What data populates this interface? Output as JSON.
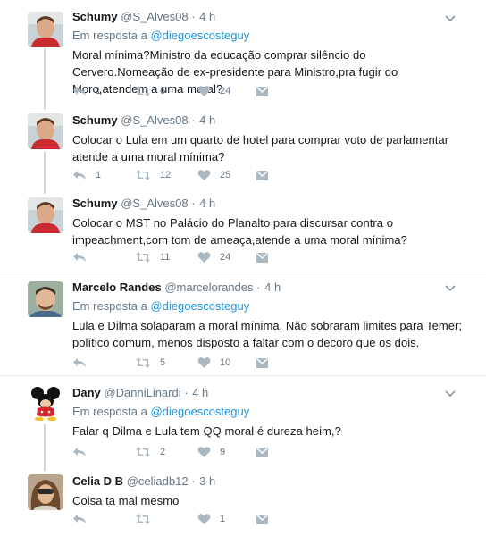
{
  "colors": {
    "link": "#1b95e0",
    "muted": "#657786",
    "text": "#14171a",
    "divider": "#e6ecf0",
    "thread": "#ccd6dd"
  },
  "icons": [
    "reply-icon",
    "retweet-icon",
    "like-icon",
    "direct-message-icon",
    "chevron-down-icon"
  ],
  "tweets": [
    {
      "name": "Schumy",
      "handle": "@S_Alves08",
      "sep": "·",
      "time": "4 h",
      "reply_prefix": "Em resposta a",
      "reply_mention": "@diegoescosteguy",
      "text": "Moral mínima?Ministro da educação comprar silêncio do Cervero.Nomeação de ex-presidente para Ministro,pra fugir do Moro,atendem a uma moral?",
      "replies": "1",
      "retweets": "6",
      "likes": "24"
    },
    {
      "name": "Schumy",
      "handle": "@S_Alves08",
      "sep": "·",
      "time": "4 h",
      "text": "Colocar o Lula em um quarto de hotel para comprar voto de parlamentar atende a uma moral mínima?",
      "replies": "1",
      "retweets": "12",
      "likes": "25"
    },
    {
      "name": "Schumy",
      "handle": "@S_Alves08",
      "sep": "·",
      "time": "4 h",
      "text": "Colocar o MST no Palácio do Planalto para discursar contra o impeachment,com tom de ameaça,atende a uma moral mínima?",
      "replies": "",
      "retweets": "11",
      "likes": "24"
    },
    {
      "name": "Marcelo Randes",
      "handle": "@marcelorandes",
      "sep": "·",
      "time": "4 h",
      "reply_prefix": "Em resposta a",
      "reply_mention": "@diegoescosteguy",
      "text": "Lula e Dilma solaparam a moral mínima. Não sobraram limites para Temer; político comum, menos disposto a faltar com o decoro que os dois.",
      "replies": "",
      "retweets": "5",
      "likes": "10"
    },
    {
      "name": "Dany",
      "handle": "@DanniLinardi",
      "sep": "·",
      "time": "4 h",
      "reply_prefix": "Em resposta a",
      "reply_mention": "@diegoescosteguy",
      "text": "Falar q Dilma e Lula tem QQ moral é dureza heim,?",
      "replies": "",
      "retweets": "2",
      "likes": "9"
    },
    {
      "name": "Celia D B",
      "handle": "@celiadb12",
      "sep": "·",
      "time": "3 h",
      "text": "Coisa ta mal mesmo",
      "replies": "",
      "retweets": "",
      "likes": "1"
    }
  ]
}
